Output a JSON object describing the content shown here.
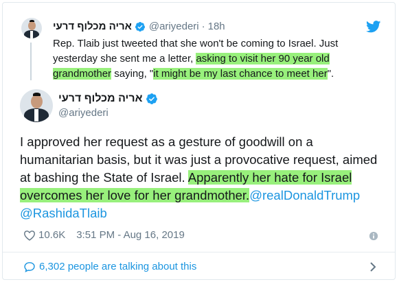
{
  "quoted": {
    "name": "אריה מכלוף דרעי",
    "handle": "@ariyederi",
    "dot": "·",
    "time": "18h",
    "text_1": "Rep. Tlaib just tweeted that she won't be coming to Israel. Just yesterday she sent me a letter, ",
    "text_hl_1": "asking to visit her 90 year old grandmother",
    "text_2": " saying, \"",
    "text_hl_2": "it might be my last chance to meet her",
    "text_3": "\"."
  },
  "main": {
    "name": "אריה מכלוף דרעי",
    "handle": "@ariyederi",
    "text_plain": "I approved her request as a gesture of goodwill on a humanitarian basis, but it was just a provocative request, aimed at bashing the State of Israel. ",
    "text_hl": "Apparently her hate for Israel overcomes her love for her grandmother.",
    "mention_1": "@realDonaldTrump",
    "mention_2": "@RashidaTlaib"
  },
  "meta": {
    "likes": "10.6K",
    "time": "3:51 PM - Aug 16, 2019"
  },
  "footer": {
    "talking": "6,302 people are talking about this"
  },
  "colors": {
    "highlight": "#98f07c",
    "link": "#1b95e0",
    "verified": "#1da1f2",
    "twitter": "#1da1f2"
  },
  "icons": {
    "verified": "verified-badge-icon",
    "bird": "twitter-bird-icon",
    "heart": "heart-icon",
    "info": "info-icon",
    "bubble": "speech-bubble-icon",
    "chevron": "chevron-right-icon"
  }
}
